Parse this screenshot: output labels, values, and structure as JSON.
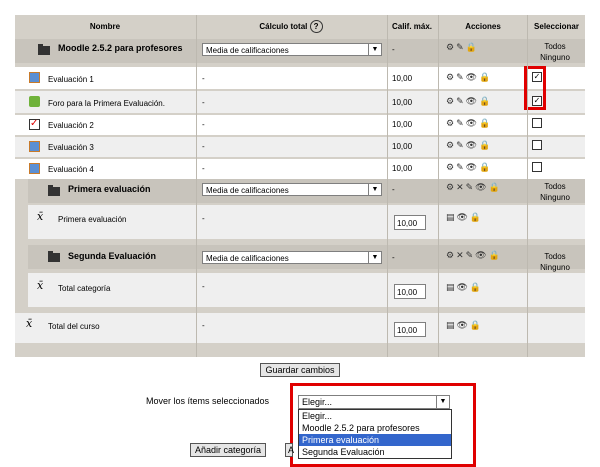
{
  "columns": {
    "name": "Nombre",
    "calc": "Cálculo total",
    "max": "Calif. máx.",
    "actions": "Acciones",
    "select": "Seleccionar"
  },
  "course_category": {
    "name": "Moodle 2.5.2 para profesores",
    "agg": "Media de calificaciones",
    "max": "-",
    "todos": "Todos",
    "ninguno": "Ninguno"
  },
  "items": [
    {
      "name": "Evaluación 1",
      "calc": "-",
      "max": "10,00",
      "checked": true,
      "icon": "assignment-icon"
    },
    {
      "name": "Foro para la Primera Evaluación.",
      "calc": "-",
      "max": "10,00",
      "checked": true,
      "icon": "forum-icon"
    },
    {
      "name": "Evaluación 2",
      "calc": "-",
      "max": "10,00",
      "checked": false,
      "icon": "quiz-icon"
    },
    {
      "name": "Evaluación 3",
      "calc": "-",
      "max": "10,00",
      "checked": false,
      "icon": "assignment-icon"
    },
    {
      "name": "Evaluación 4",
      "calc": "-",
      "max": "10,00",
      "checked": false,
      "icon": "assignment-icon"
    }
  ],
  "cat1": {
    "name": "Primera evaluación",
    "agg": "Media de calificaciones",
    "max": "-",
    "todos": "Todos",
    "ninguno": "Ninguno",
    "total_name": "Primera evaluación",
    "total_calc": "-",
    "total_max": "10,00"
  },
  "cat2": {
    "name": "Segunda Evaluación",
    "agg": "Media de calificaciones",
    "max": "-",
    "todos": "Todos",
    "ninguno": "Ninguno",
    "total_name": "Total categoría",
    "total_calc": "-",
    "total_max": "10,00"
  },
  "course_total": {
    "name": "Total del curso",
    "calc": "-",
    "max": "10,00"
  },
  "save_button": "Guardar cambios",
  "move_label": "Mover los ítems seleccionados",
  "move_select": {
    "value": "Elegir...",
    "options": [
      "Elegir...",
      "Moodle 2.5.2 para profesores",
      "Primera evaluación",
      "Segunda Evaluación"
    ],
    "highlighted": 2
  },
  "add_category_button": "Añadir categoría",
  "add_item_button_partial": "A",
  "colors": {
    "highlight": "#e00000",
    "selected_option": "#3366cc",
    "header_bg": "#d4d0c8"
  }
}
